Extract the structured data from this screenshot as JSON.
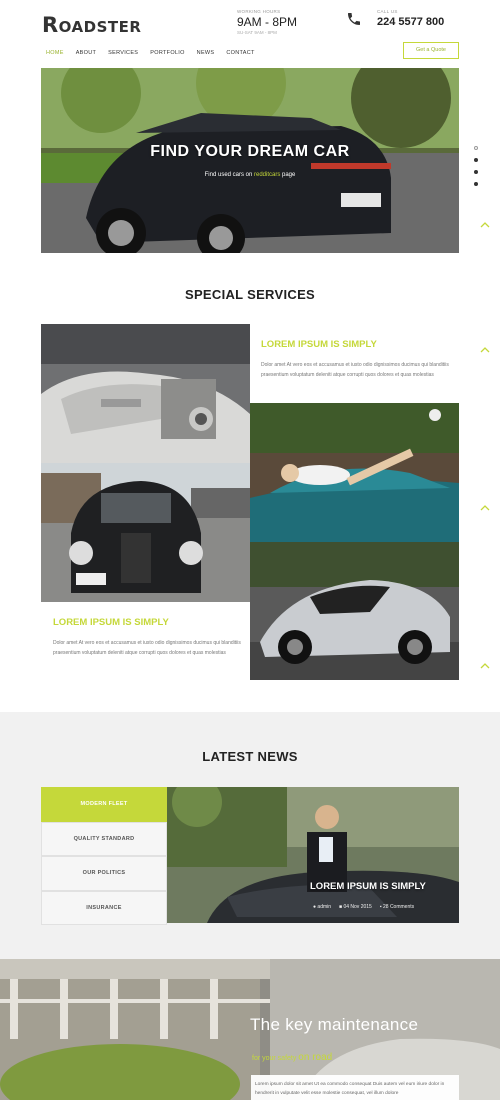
{
  "brand": {
    "logo_first": "R",
    "logo_rest": "OADSTER",
    "accent": "#c5d83a",
    "dark": "#222222"
  },
  "header": {
    "hours_label": "WORKING HOURS",
    "hours_value": "9AM - 8PM",
    "hours_sub": "SU-SAT 9AM - 8PM",
    "call_label": "CALL US",
    "phone": "224 5577 800",
    "phone_icon": "phone-icon"
  },
  "nav": {
    "items": [
      {
        "label": "HOME",
        "active": true
      },
      {
        "label": "ABOUT"
      },
      {
        "label": "SERVICES"
      },
      {
        "label": "PORTFOLIO"
      },
      {
        "label": "NEWS"
      },
      {
        "label": "CONTACT"
      }
    ],
    "quote_button": "Get a Quote"
  },
  "hero": {
    "title": "FIND YOUR DREAM CAR",
    "subtitle_pre": "Find used cars on ",
    "subtitle_accent": "redditcars",
    "subtitle_post": " page"
  },
  "services": {
    "title": "SPECIAL SERVICES",
    "card1": {
      "title": "LOREM IPSUM IS SIMPLY",
      "text": "Dolor amet At vero eos et accusamus et iusto odio dignissimos ducimus qui blanditiis praesentium voluptatum deleniti atque corrupti quos dolores et quas molestias"
    },
    "card2": {
      "title": "LOREM IPSUM IS SIMPLY",
      "text": "Dolor amet At vero eos et accusamus et iusto odio dignissimos ducimus qui blanditiis praesentium voluptatum deleniti atque corrupti quos dolores et quas molestias"
    }
  },
  "news": {
    "title": "LATEST NEWS",
    "tabs": [
      {
        "label": "MODERN FLEET",
        "active": true
      },
      {
        "label": "QUALITY STANDARD"
      },
      {
        "label": "OUR POLITICS"
      },
      {
        "label": "INSURANCE"
      }
    ],
    "caption": "LOREM IPSUM IS SIMPLY",
    "author": "admin",
    "date": "04 Nov 2015",
    "comments": "28 Comments"
  },
  "maintenance": {
    "title": "The key maintenance",
    "subtitle_pre": "for your safety ",
    "subtitle_accent": "on road",
    "text": "Lorem ipsum dolor sit amet Ut ea commodo consequat Duis autem vel eum iriure dolor in hendrerit in vulputate velit esse molestie consequat, vel illum dolore"
  }
}
